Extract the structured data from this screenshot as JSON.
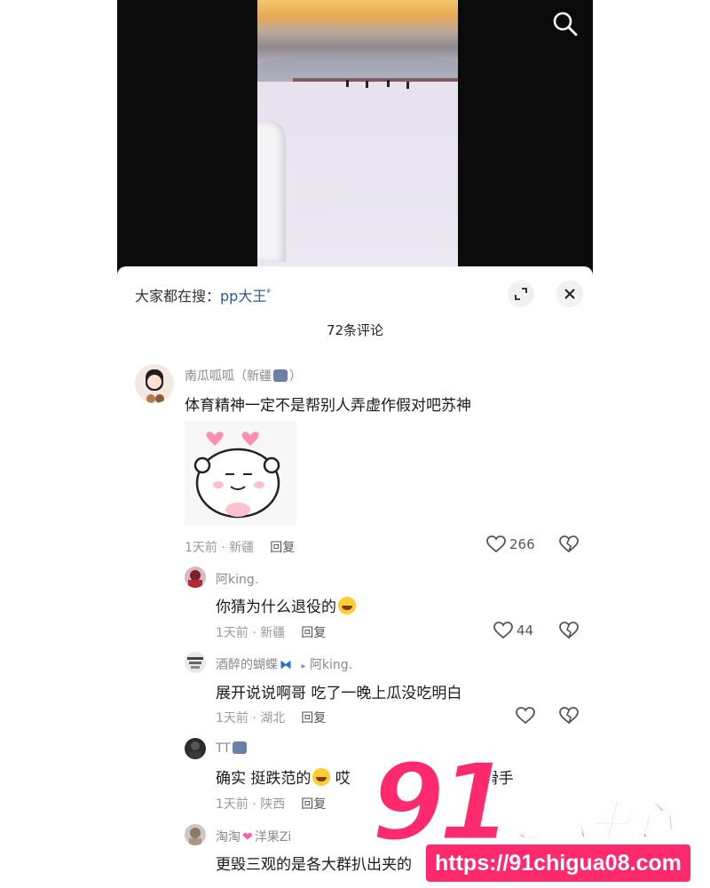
{
  "video": {
    "search_icon": "search-icon"
  },
  "sheet": {
    "search_hint_prefix": "大家都在搜：",
    "search_term": "pp大王",
    "search_term_icon": "ᵠ",
    "expand_icon": "expand-icon",
    "close_icon": "close-icon",
    "comment_count": "72条评论"
  },
  "comments": [
    {
      "user": "南瓜呱呱（新疆",
      "user_suffix": "）",
      "text": "体育精神一定不是帮别人弄虚作假对吧苏神",
      "time": "1天前 · 新疆",
      "reply": "回复",
      "likes": "266"
    },
    {
      "user": "阿king.",
      "text": "你猜为什么退役的",
      "time": "1天前 · 新疆",
      "reply": "回复",
      "likes": "44"
    },
    {
      "user": "酒醉的蝴蝶",
      "reply_to_arrow": "▸",
      "reply_to": "阿king.",
      "text": "展开说说啊哥 吃了一晚上瓜没吃明白",
      "time": "1天前 · 湖北",
      "reply": "回复",
      "likes": ""
    },
    {
      "user": "TT",
      "text_a": "确实 挺跌范的",
      "text_b": " 哎",
      "text_c": "滑手",
      "time": "1天前 · 陕西",
      "reply": "回复"
    },
    {
      "user_a": "淘淘",
      "user_b": "洋果Zi",
      "text": "更毁三观的是各大群扒出夹的"
    }
  ],
  "watermark": {
    "digits": "91",
    "brand": "吃瓜中心",
    "url": "https://91chigua08.com"
  },
  "colors": {
    "accent_link": "#2f5b8f",
    "watermark": "#ff2a6d"
  }
}
